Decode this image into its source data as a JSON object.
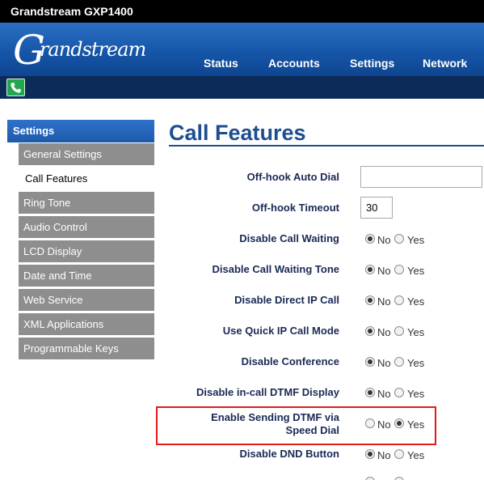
{
  "app": {
    "title": "Grandstream GXP1400",
    "logo_text": "Grandstream"
  },
  "nav": {
    "status": "Status",
    "accounts": "Accounts",
    "settings": "Settings",
    "network": "Network"
  },
  "icons": {
    "phone": "phone-icon"
  },
  "sidebar": {
    "heading": "Settings",
    "items": [
      {
        "label": "General Settings"
      },
      {
        "label": "Call Features"
      },
      {
        "label": "Ring Tone"
      },
      {
        "label": "Audio Control"
      },
      {
        "label": "LCD Display"
      },
      {
        "label": "Date and Time"
      },
      {
        "label": "Web Service"
      },
      {
        "label": "XML Applications"
      },
      {
        "label": "Programmable Keys"
      }
    ],
    "active": "Call Features"
  },
  "main": {
    "title": "Call Features",
    "offhook_auto_dial": {
      "label": "Off-hook Auto Dial",
      "value": ""
    },
    "offhook_timeout": {
      "label": "Off-hook Timeout",
      "value": "30"
    },
    "radio_no": "No",
    "radio_yes": "Yes",
    "rows": [
      {
        "label": "Disable Call Waiting",
        "selected": "No"
      },
      {
        "label": "Disable Call Waiting Tone",
        "selected": "No"
      },
      {
        "label": "Disable Direct IP Call",
        "selected": "No"
      },
      {
        "label": "Use Quick IP Call Mode",
        "selected": "No"
      },
      {
        "label": "Disable Conference",
        "selected": "No"
      },
      {
        "label": "Disable in-call DTMF Display",
        "selected": "No"
      },
      {
        "label": "Enable Sending DTMF via Speed Dial",
        "selected": "Yes"
      },
      {
        "label": "Disable DND Button",
        "selected": "No"
      }
    ]
  },
  "colors": {
    "banner": "#1656a8",
    "title": "#1d4e8f",
    "highlight": "#e21b1b",
    "sidebar_item": "#8e8e8e"
  }
}
